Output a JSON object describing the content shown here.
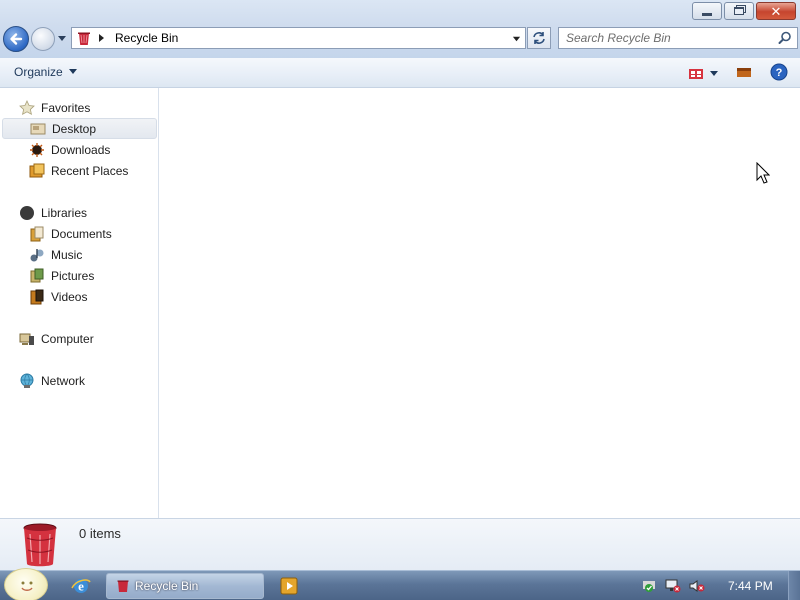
{
  "window": {
    "title": "Recycle Bin",
    "caption_buttons": [
      "minimize",
      "maximize",
      "close"
    ]
  },
  "address_bar": {
    "location": "Recycle Bin",
    "icon": "recycle-bin-icon"
  },
  "search": {
    "placeholder": "Search Recycle Bin"
  },
  "command_bar": {
    "organize_label": "Organize",
    "right_buttons": [
      "change-view-icon",
      "preview-pane-icon",
      "help-icon"
    ]
  },
  "nav_pane": {
    "favorites": {
      "label": "Favorites",
      "items": [
        {
          "label": "Desktop",
          "icon": "desktop-icon",
          "selected": true
        },
        {
          "label": "Downloads",
          "icon": "downloads-icon"
        },
        {
          "label": "Recent Places",
          "icon": "recent-places-icon"
        }
      ]
    },
    "libraries": {
      "label": "Libraries",
      "items": [
        {
          "label": "Documents",
          "icon": "documents-icon"
        },
        {
          "label": "Music",
          "icon": "music-icon"
        },
        {
          "label": "Pictures",
          "icon": "pictures-icon"
        },
        {
          "label": "Videos",
          "icon": "videos-icon"
        }
      ]
    },
    "computer": {
      "label": "Computer"
    },
    "network": {
      "label": "Network"
    }
  },
  "details": {
    "item_count": "0 items"
  },
  "taskbar": {
    "task_label": "Recycle Bin",
    "clock": "7:44 PM"
  },
  "colors": {
    "accent": "#2d68c4",
    "close_red": "#c6452f",
    "taskbar": "#5b7598"
  }
}
